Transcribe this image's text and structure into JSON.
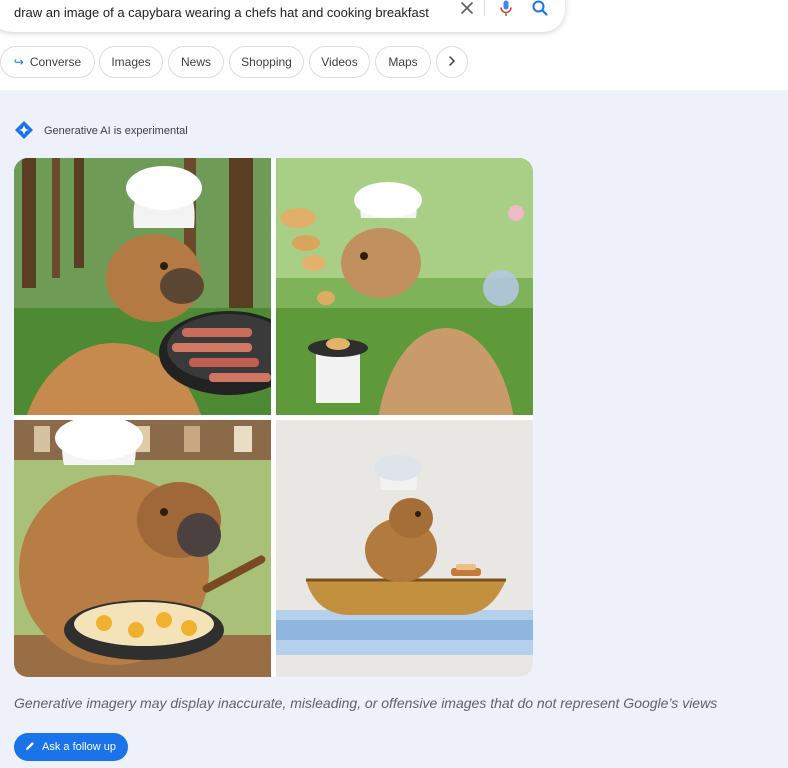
{
  "search": {
    "query": "draw an image of a capybara wearing a chefs hat and cooking breakfast",
    "clear_icon": "close-icon",
    "mic_icon": "microphone-icon",
    "search_icon": "search-icon"
  },
  "chips": [
    {
      "label": "Converse",
      "icon": "arrow-return-icon"
    },
    {
      "label": "Images"
    },
    {
      "label": "News"
    },
    {
      "label": "Shopping"
    },
    {
      "label": "Videos"
    },
    {
      "label": "Maps"
    },
    {
      "label": "",
      "icon": "chevron-right-icon"
    }
  ],
  "generative": {
    "label": "Generative AI is experimental",
    "icon": "sparkle-icon",
    "accent": "#1a73e8",
    "panel_bg": "#eef1f9",
    "images": [
      {
        "subject": "capybara in chef hat grilling bacon in forest"
      },
      {
        "subject": "capybara in chef hat flipping pancakes in garden"
      },
      {
        "subject": "capybara in chef hat frying eggs in kitchen"
      },
      {
        "subject": "capybara in chef hat in a boat with toast"
      }
    ],
    "disclaimer": "Generative imagery may display inaccurate, misleading, or offensive images that do not represent Google’s views",
    "followup_label": "Ask a follow up",
    "followup_icon": "pencil-icon"
  }
}
